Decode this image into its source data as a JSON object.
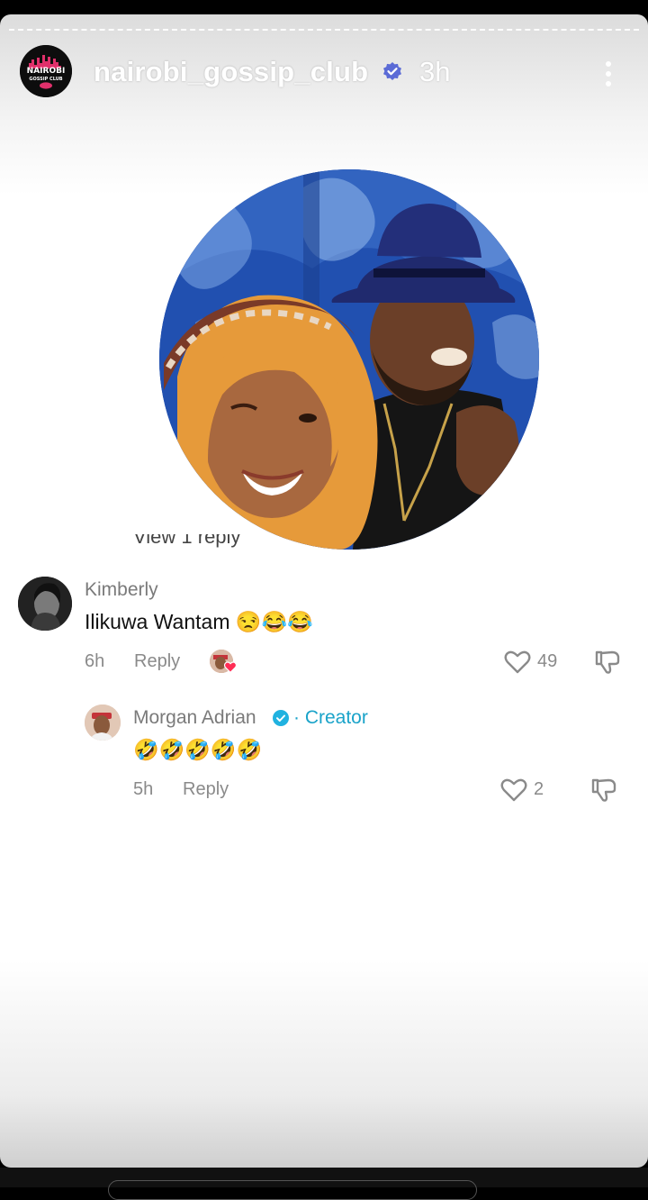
{
  "story": {
    "username": "nairobi_gossip_club",
    "time": "3h",
    "logo": {
      "line1": "NAIROBI",
      "line2": "GOSSIP CLUB"
    }
  },
  "partial_text": "View 1 reply",
  "comments": [
    {
      "author": "Kimberly",
      "text": "Ilikuwa Wantam 😒😂😂",
      "time": "6h",
      "reply_label": "Reply",
      "likes": "49"
    },
    {
      "author": "Morgan Adrian",
      "badge": "· Creator",
      "text": "🤣🤣🤣🤣🤣",
      "time": "5h",
      "reply_label": "Reply",
      "likes": "2"
    }
  ],
  "colors": {
    "creator": "#1aa3c9",
    "verified": "#5b6bd6",
    "like_heart": "#ff2d55"
  }
}
